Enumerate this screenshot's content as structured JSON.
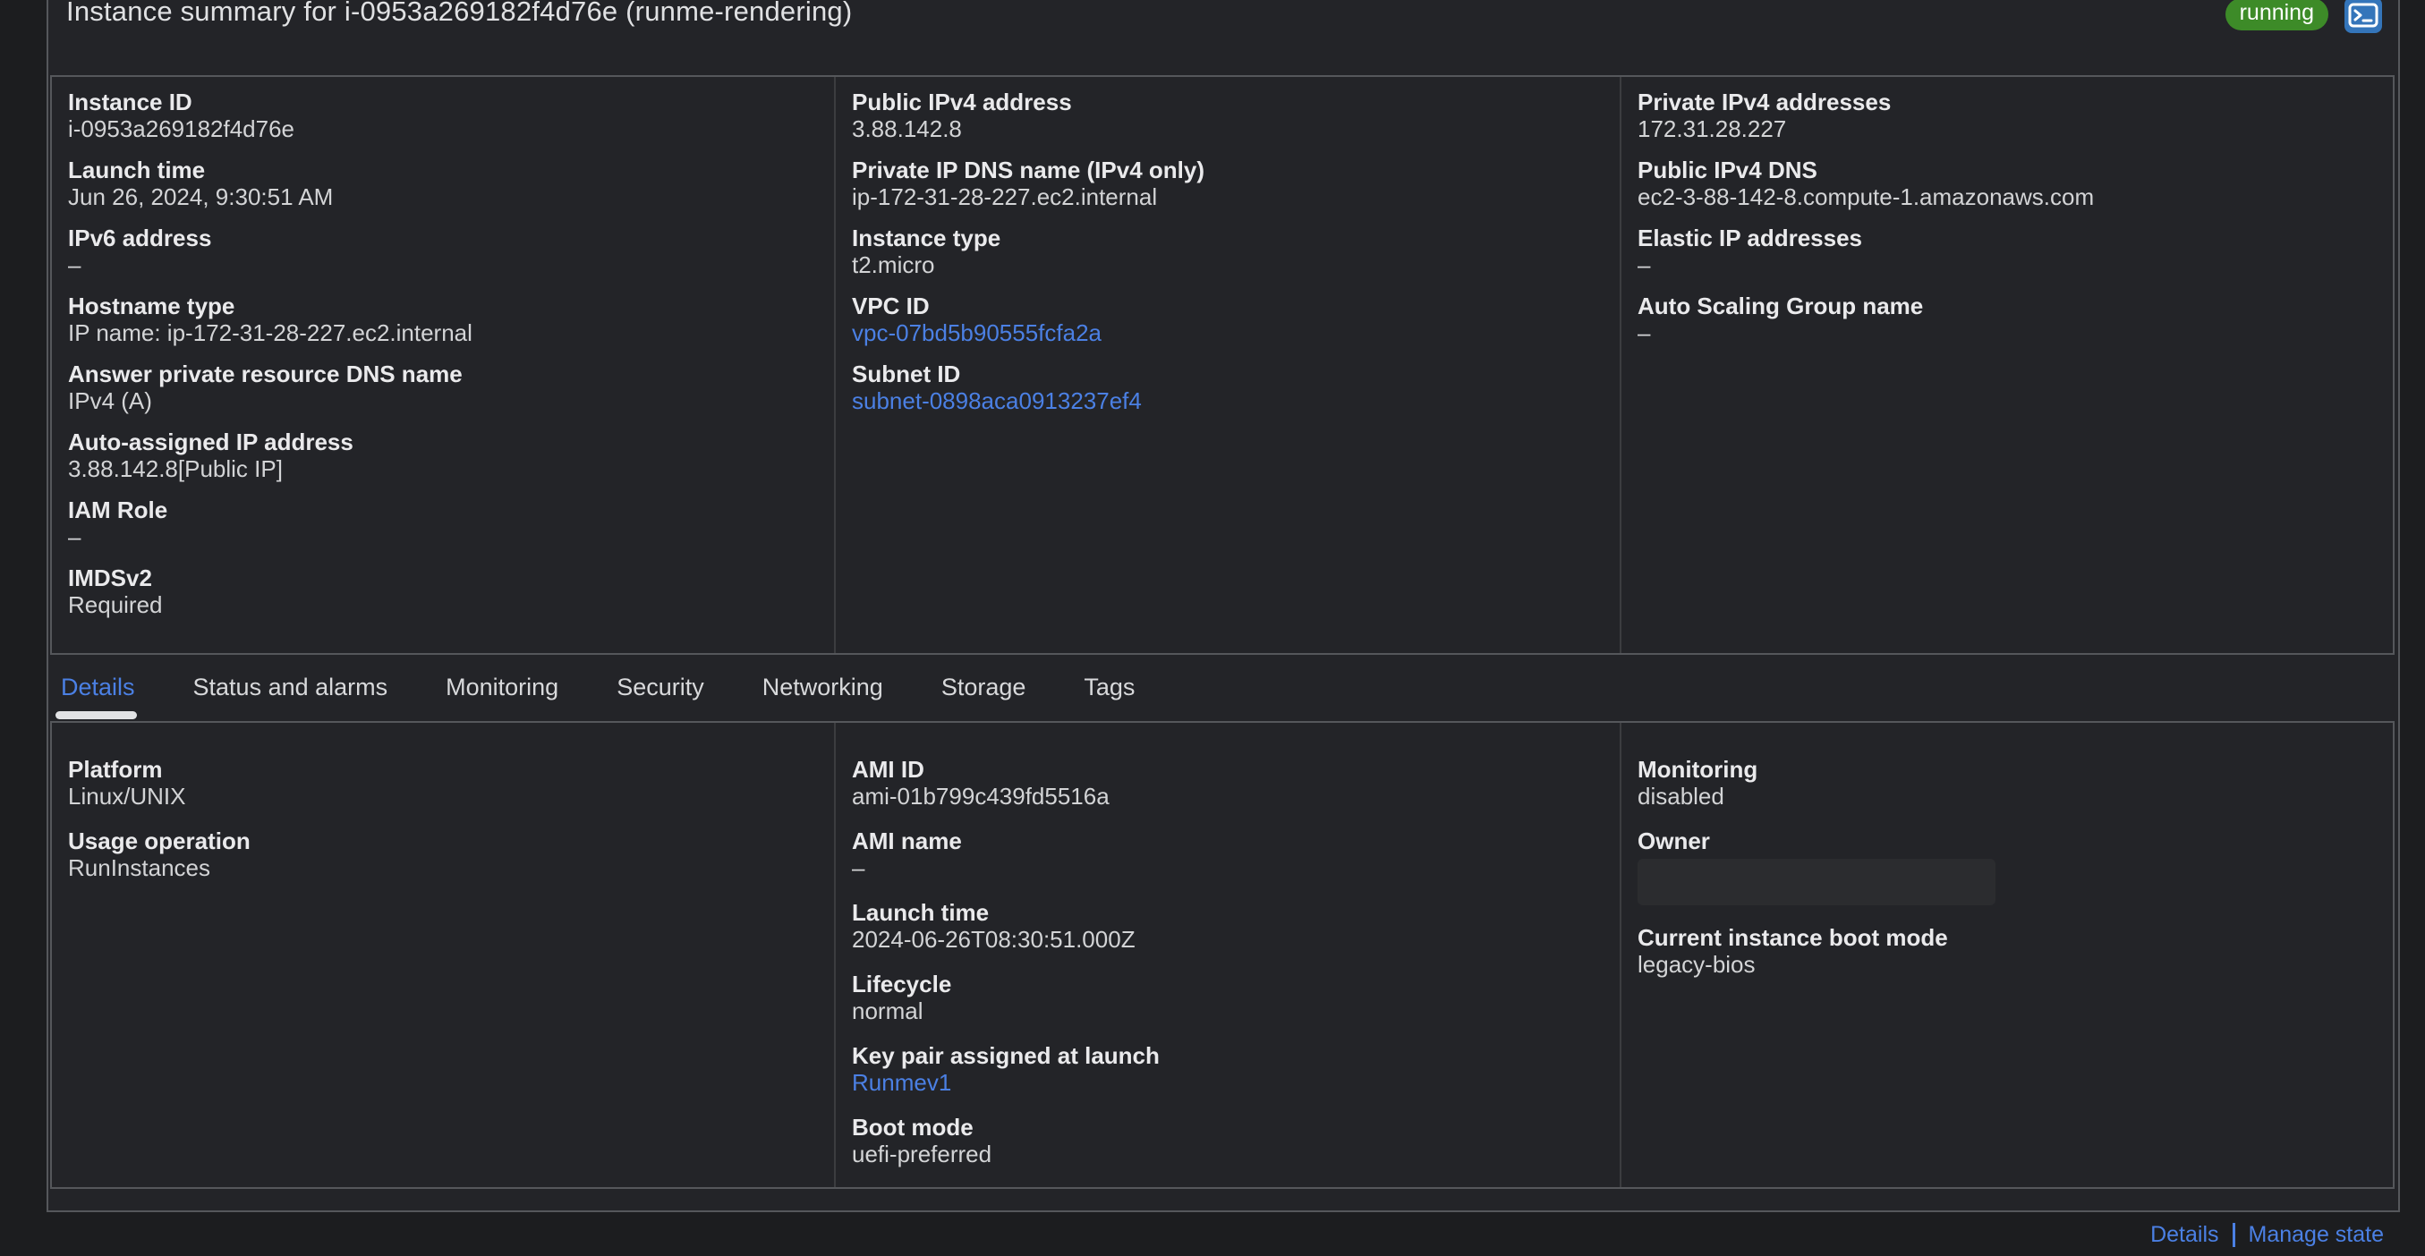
{
  "colors": {
    "green": "#3d8b28",
    "btn_blue": "#3475ba",
    "link": "#4b80e4"
  },
  "header": {
    "title": "Instance summary for i-0953a269182f4d76e (runme-rendering)",
    "status_badge": "running",
    "connect_icon": "terminal-icon"
  },
  "summary": {
    "columns": [
      {
        "fields": [
          {
            "label": "Instance ID",
            "value": "i-0953a269182f4d76e"
          },
          {
            "label": "Launch time",
            "value": "Jun 26, 2024, 9:30:51 AM"
          },
          {
            "label": "IPv6 address",
            "value": "–"
          },
          {
            "label": "Hostname type",
            "value": "IP name: ip-172-31-28-227.ec2.internal"
          },
          {
            "label": "Answer private resource DNS name",
            "value": "IPv4 (A)"
          },
          {
            "label": "Auto-assigned IP address",
            "value": "3.88.142.8[Public IP]"
          },
          {
            "label": "IAM Role",
            "value": "–"
          },
          {
            "label": "IMDSv2",
            "value": "Required"
          }
        ]
      },
      {
        "fields": [
          {
            "label": "Public IPv4 address",
            "value": "3.88.142.8"
          },
          {
            "label": "Private IP DNS name (IPv4 only)",
            "value": "ip-172-31-28-227.ec2.internal"
          },
          {
            "label": "Instance type",
            "value": "t2.micro"
          },
          {
            "label": "VPC ID",
            "value": "vpc-07bd5b90555fcfa2a",
            "link": true
          },
          {
            "label": "Subnet ID",
            "value": "subnet-0898aca0913237ef4",
            "link": true
          }
        ]
      },
      {
        "fields": [
          {
            "label": "Private IPv4 addresses",
            "value": "172.31.28.227"
          },
          {
            "label": "Public IPv4 DNS",
            "value": "ec2-3-88-142-8.compute-1.amazonaws.com"
          },
          {
            "label": "Elastic IP addresses",
            "value": "–"
          },
          {
            "label": "Auto Scaling Group name",
            "value": "–"
          }
        ]
      }
    ]
  },
  "tabs": {
    "active": "Details",
    "items": [
      {
        "label": "Details"
      },
      {
        "label": "Status and alarms"
      },
      {
        "label": "Monitoring"
      },
      {
        "label": "Security"
      },
      {
        "label": "Networking"
      },
      {
        "label": "Storage"
      },
      {
        "label": "Tags"
      }
    ]
  },
  "details": {
    "columns": [
      {
        "fields": [
          {
            "label": "Platform",
            "value": "Linux/UNIX"
          },
          {
            "label": "Usage operation",
            "value": "RunInstances"
          }
        ]
      },
      {
        "fields": [
          {
            "label": "AMI ID",
            "value": "ami-01b799c439fd5516a"
          },
          {
            "label": "AMI name",
            "value": "–"
          },
          {
            "label": "Launch time",
            "value": "2024-06-26T08:30:51.000Z"
          },
          {
            "label": "Lifecycle",
            "value": "normal"
          },
          {
            "label": "Key pair assigned at launch",
            "value": "Runmev1",
            "link": true
          },
          {
            "label": "Boot mode",
            "value": "uefi-preferred"
          }
        ]
      },
      {
        "fields": [
          {
            "label": "Monitoring",
            "value": "disabled"
          },
          {
            "label": "Owner",
            "value": "",
            "redacted": true
          },
          {
            "label": "Current instance boot mode",
            "value": "legacy-bios"
          }
        ]
      }
    ]
  },
  "footer": {
    "details_label": "Details",
    "manage_state_label": "Manage state"
  }
}
